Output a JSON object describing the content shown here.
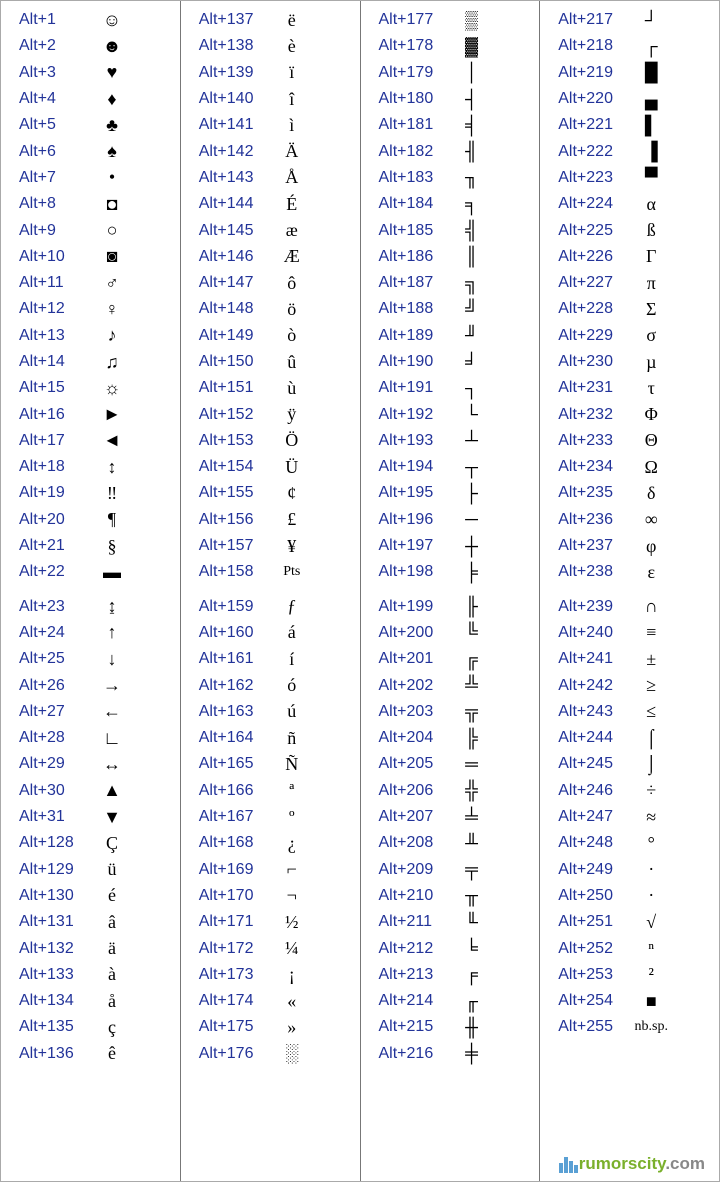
{
  "columns": [
    {
      "rows": [
        {
          "code": "Alt+1",
          "sym": "☺"
        },
        {
          "code": "Alt+2",
          "sym": "☻"
        },
        {
          "code": "Alt+3",
          "sym": "♥"
        },
        {
          "code": "Alt+4",
          "sym": "♦"
        },
        {
          "code": "Alt+5",
          "sym": "♣"
        },
        {
          "code": "Alt+6",
          "sym": "♠"
        },
        {
          "code": "Alt+7",
          "sym": "•"
        },
        {
          "code": "Alt+8",
          "sym": "◘"
        },
        {
          "code": "Alt+9",
          "sym": "○"
        },
        {
          "code": "Alt+10",
          "sym": "◙"
        },
        {
          "code": "Alt+11",
          "sym": "♂"
        },
        {
          "code": "Alt+12",
          "sym": "♀"
        },
        {
          "code": "Alt+13",
          "sym": "♪"
        },
        {
          "code": "Alt+14",
          "sym": "♫"
        },
        {
          "code": "Alt+15",
          "sym": "☼"
        },
        {
          "code": "Alt+16",
          "sym": "►"
        },
        {
          "code": "Alt+17",
          "sym": "◄"
        },
        {
          "code": "Alt+18",
          "sym": "↕"
        },
        {
          "code": "Alt+19",
          "sym": "‼"
        },
        {
          "code": "Alt+20",
          "sym": "¶"
        },
        {
          "code": "Alt+21",
          "sym": "§"
        },
        {
          "code": "Alt+22",
          "sym": "▬"
        },
        {
          "split": true
        },
        {
          "code": "Alt+23",
          "sym": "↨"
        },
        {
          "code": "Alt+24",
          "sym": "↑"
        },
        {
          "code": "Alt+25",
          "sym": "↓"
        },
        {
          "code": "Alt+26",
          "sym": "→"
        },
        {
          "code": "Alt+27",
          "sym": "←"
        },
        {
          "code": "Alt+28",
          "sym": "∟"
        },
        {
          "code": "Alt+29",
          "sym": "↔"
        },
        {
          "code": "Alt+30",
          "sym": "▲"
        },
        {
          "code": "Alt+31",
          "sym": "▼"
        },
        {
          "code": "Alt+128",
          "sym": "Ç"
        },
        {
          "code": "Alt+129",
          "sym": "ü"
        },
        {
          "code": "Alt+130",
          "sym": "é"
        },
        {
          "code": "Alt+131",
          "sym": "â"
        },
        {
          "code": "Alt+132",
          "sym": "ä"
        },
        {
          "code": "Alt+133",
          "sym": "à"
        },
        {
          "code": "Alt+134",
          "sym": "å"
        },
        {
          "code": "Alt+135",
          "sym": "ç"
        },
        {
          "code": "Alt+136",
          "sym": "ê"
        }
      ]
    },
    {
      "rows": [
        {
          "code": "Alt+137",
          "sym": "ë"
        },
        {
          "code": "Alt+138",
          "sym": "è"
        },
        {
          "code": "Alt+139",
          "sym": "ï"
        },
        {
          "code": "Alt+140",
          "sym": "î"
        },
        {
          "code": "Alt+141",
          "sym": "ì"
        },
        {
          "code": "Alt+142",
          "sym": "Ä"
        },
        {
          "code": "Alt+143",
          "sym": "Å"
        },
        {
          "code": "Alt+144",
          "sym": "É"
        },
        {
          "code": "Alt+145",
          "sym": "æ"
        },
        {
          "code": "Alt+146",
          "sym": "Æ"
        },
        {
          "code": "Alt+147",
          "sym": "ô"
        },
        {
          "code": "Alt+148",
          "sym": "ö"
        },
        {
          "code": "Alt+149",
          "sym": "ò"
        },
        {
          "code": "Alt+150",
          "sym": "û"
        },
        {
          "code": "Alt+151",
          "sym": "ù"
        },
        {
          "code": "Alt+152",
          "sym": "ÿ"
        },
        {
          "code": "Alt+153",
          "sym": "Ö"
        },
        {
          "code": "Alt+154",
          "sym": "Ü"
        },
        {
          "code": "Alt+155",
          "sym": "¢"
        },
        {
          "code": "Alt+156",
          "sym": "£"
        },
        {
          "code": "Alt+157",
          "sym": "¥"
        },
        {
          "code": "Alt+158",
          "sym": "Pts"
        },
        {
          "split": true
        },
        {
          "code": "Alt+159",
          "sym": "ƒ"
        },
        {
          "code": "Alt+160",
          "sym": "á"
        },
        {
          "code": "Alt+161",
          "sym": "í"
        },
        {
          "code": "Alt+162",
          "sym": "ó"
        },
        {
          "code": "Alt+163",
          "sym": "ú"
        },
        {
          "code": "Alt+164",
          "sym": "ñ"
        },
        {
          "code": "Alt+165",
          "sym": "Ñ"
        },
        {
          "code": "Alt+166",
          "sym": "ª"
        },
        {
          "code": "Alt+167",
          "sym": "º"
        },
        {
          "code": "Alt+168",
          "sym": "¿"
        },
        {
          "code": "Alt+169",
          "sym": "⌐"
        },
        {
          "code": "Alt+170",
          "sym": "¬"
        },
        {
          "code": "Alt+171",
          "sym": "½"
        },
        {
          "code": "Alt+172",
          "sym": "¼"
        },
        {
          "code": "Alt+173",
          "sym": "¡"
        },
        {
          "code": "Alt+174",
          "sym": "«"
        },
        {
          "code": "Alt+175",
          "sym": "»"
        },
        {
          "code": "Alt+176",
          "sym": "░"
        }
      ]
    },
    {
      "rows": [
        {
          "code": "Alt+177",
          "sym": "▒"
        },
        {
          "code": "Alt+178",
          "sym": "▓"
        },
        {
          "code": "Alt+179",
          "sym": "│"
        },
        {
          "code": "Alt+180",
          "sym": "┤"
        },
        {
          "code": "Alt+181",
          "sym": "╡"
        },
        {
          "code": "Alt+182",
          "sym": "╢"
        },
        {
          "code": "Alt+183",
          "sym": "╖"
        },
        {
          "code": "Alt+184",
          "sym": "╕"
        },
        {
          "code": "Alt+185",
          "sym": "╣"
        },
        {
          "code": "Alt+186",
          "sym": "║"
        },
        {
          "code": "Alt+187",
          "sym": "╗"
        },
        {
          "code": "Alt+188",
          "sym": "╝"
        },
        {
          "code": "Alt+189",
          "sym": "╜"
        },
        {
          "code": "Alt+190",
          "sym": "╛"
        },
        {
          "code": "Alt+191",
          "sym": "┐"
        },
        {
          "code": "Alt+192",
          "sym": "└"
        },
        {
          "code": "Alt+193",
          "sym": "┴"
        },
        {
          "code": "Alt+194",
          "sym": "┬"
        },
        {
          "code": "Alt+195",
          "sym": "├"
        },
        {
          "code": "Alt+196",
          "sym": "─"
        },
        {
          "code": "Alt+197",
          "sym": "┼"
        },
        {
          "code": "Alt+198",
          "sym": "╞"
        },
        {
          "split": true
        },
        {
          "code": "Alt+199",
          "sym": "╟"
        },
        {
          "code": "Alt+200",
          "sym": "╚"
        },
        {
          "code": "Alt+201",
          "sym": "╔"
        },
        {
          "code": "Alt+202",
          "sym": "╩"
        },
        {
          "code": "Alt+203",
          "sym": "╦"
        },
        {
          "code": "Alt+204",
          "sym": "╠"
        },
        {
          "code": "Alt+205",
          "sym": "═"
        },
        {
          "code": "Alt+206",
          "sym": "╬"
        },
        {
          "code": "Alt+207",
          "sym": "╧"
        },
        {
          "code": "Alt+208",
          "sym": "╨"
        },
        {
          "code": "Alt+209",
          "sym": "╤"
        },
        {
          "code": "Alt+210",
          "sym": "╥"
        },
        {
          "code": "Alt+211",
          "sym": "╙"
        },
        {
          "code": "Alt+212",
          "sym": "╘"
        },
        {
          "code": "Alt+213",
          "sym": "╒"
        },
        {
          "code": "Alt+214",
          "sym": "╓"
        },
        {
          "code": "Alt+215",
          "sym": "╫"
        },
        {
          "code": "Alt+216",
          "sym": "╪"
        }
      ]
    },
    {
      "rows": [
        {
          "code": "Alt+217",
          "sym": "┘"
        },
        {
          "code": "Alt+218",
          "sym": "┌"
        },
        {
          "code": "Alt+219",
          "sym": "█"
        },
        {
          "code": "Alt+220",
          "sym": "▄"
        },
        {
          "code": "Alt+221",
          "sym": "▌"
        },
        {
          "code": "Alt+222",
          "sym": "▐"
        },
        {
          "code": "Alt+223",
          "sym": "▀"
        },
        {
          "code": "Alt+224",
          "sym": "α"
        },
        {
          "code": "Alt+225",
          "sym": "ß"
        },
        {
          "code": "Alt+226",
          "sym": "Γ"
        },
        {
          "code": "Alt+227",
          "sym": "π"
        },
        {
          "code": "Alt+228",
          "sym": "Σ"
        },
        {
          "code": "Alt+229",
          "sym": "σ"
        },
        {
          "code": "Alt+230",
          "sym": "µ"
        },
        {
          "code": "Alt+231",
          "sym": "τ"
        },
        {
          "code": "Alt+232",
          "sym": "Φ"
        },
        {
          "code": "Alt+233",
          "sym": "Θ"
        },
        {
          "code": "Alt+234",
          "sym": "Ω"
        },
        {
          "code": "Alt+235",
          "sym": "δ"
        },
        {
          "code": "Alt+236",
          "sym": "∞"
        },
        {
          "code": "Alt+237",
          "sym": "φ"
        },
        {
          "code": "Alt+238",
          "sym": "ε"
        },
        {
          "split": true
        },
        {
          "code": "Alt+239",
          "sym": "∩"
        },
        {
          "code": "Alt+240",
          "sym": "≡"
        },
        {
          "code": "Alt+241",
          "sym": "±"
        },
        {
          "code": "Alt+242",
          "sym": "≥"
        },
        {
          "code": "Alt+243",
          "sym": "≤"
        },
        {
          "code": "Alt+244",
          "sym": "⌠"
        },
        {
          "code": "Alt+245",
          "sym": "⌡"
        },
        {
          "code": "Alt+246",
          "sym": "÷"
        },
        {
          "code": "Alt+247",
          "sym": "≈"
        },
        {
          "code": "Alt+248",
          "sym": "°"
        },
        {
          "code": "Alt+249",
          "sym": "·"
        },
        {
          "code": "Alt+250",
          "sym": "·"
        },
        {
          "code": "Alt+251",
          "sym": "√"
        },
        {
          "code": "Alt+252",
          "sym": "ⁿ"
        },
        {
          "code": "Alt+253",
          "sym": "²"
        },
        {
          "code": "Alt+254",
          "sym": "■"
        },
        {
          "code": "Alt+255",
          "sym": "nb.sp."
        }
      ]
    }
  ],
  "watermark": {
    "text": "rumorscity",
    "suffix": ".com"
  }
}
